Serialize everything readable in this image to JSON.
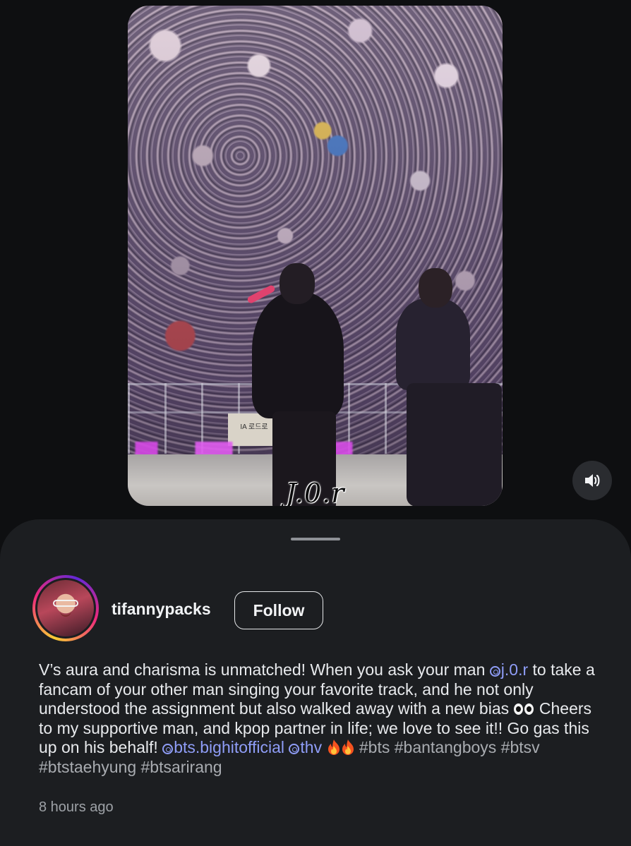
{
  "video": {
    "watermark": "J.0.r",
    "sign_text": "IA 로드로"
  },
  "controls": {
    "sound_icon": "speaker-volume-icon"
  },
  "post": {
    "username": "tifannypacks",
    "follow_label": "Follow",
    "caption": {
      "t1": "V’s aura and charisma is unmatched! When you ask your man ",
      "mention_jor": "j.0.r",
      "t2": " to take a fancam of your other man singing your favorite track, and he not only understood the assignment but also walked away with a new bias ",
      "t3": " Cheers to my supportive man, and kpop partner in life; we love to see it!! Go gas this up on his behalf! ",
      "mention_bighit": "bts.bighitofficial",
      "mention_thv": "thv",
      "hashtags": [
        "#bts",
        "#bantangboys",
        "#btsv",
        "#btstaehyung",
        "#btsarirang"
      ]
    },
    "timestamp": "8 hours ago"
  },
  "colors": {
    "background": "#0e0f11",
    "sheet": "#1c1e21",
    "mention": "#8f9df7",
    "hashtag": "#a9acb1"
  }
}
